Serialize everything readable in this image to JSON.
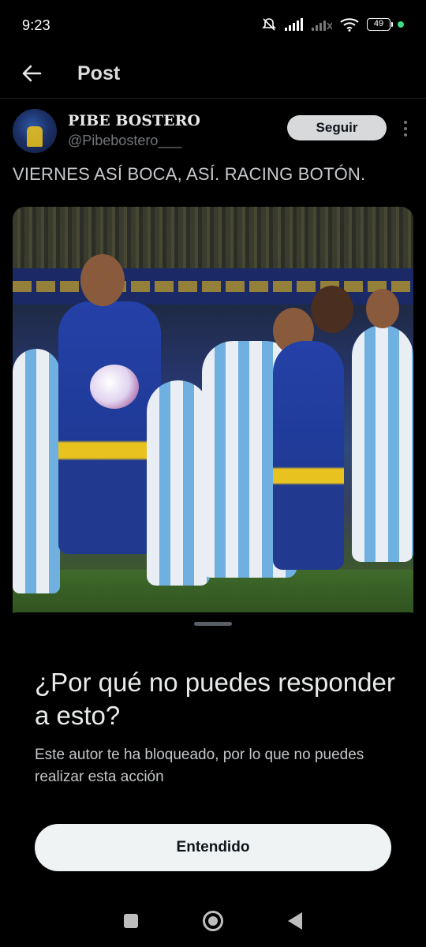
{
  "status_bar": {
    "time": "9:23",
    "battery_level": "49",
    "icons": [
      "mute-bell-icon",
      "signal-icon",
      "signal-2-icon",
      "wifi-icon",
      "battery-icon",
      "charging-dot-icon"
    ]
  },
  "header": {
    "title": "Post",
    "back_icon": "arrow-left-icon"
  },
  "post": {
    "author_name": "PIBE BOSTERO",
    "author_handle": "@Pibebostero___",
    "follow_label": "Seguir",
    "more_icon": "more-vertical-icon",
    "text": "VIERNES ASÍ BOCA, ASÍ. RACING BOTÓN.",
    "media_icon": "photo-icon"
  },
  "sheet": {
    "title": "¿Por qué no puedes responder a esto?",
    "body": "Este autor te ha bloqueado, por lo que no puedes realizar esta acción",
    "button_label": "Entendido"
  },
  "navbar": {
    "icons": [
      "recents-icon",
      "home-icon",
      "back-icon"
    ]
  },
  "colors": {
    "background": "#000000",
    "follow_button": "#d7d9db",
    "primary_button": "#eff3f4",
    "secondary_text": "#71767b"
  }
}
